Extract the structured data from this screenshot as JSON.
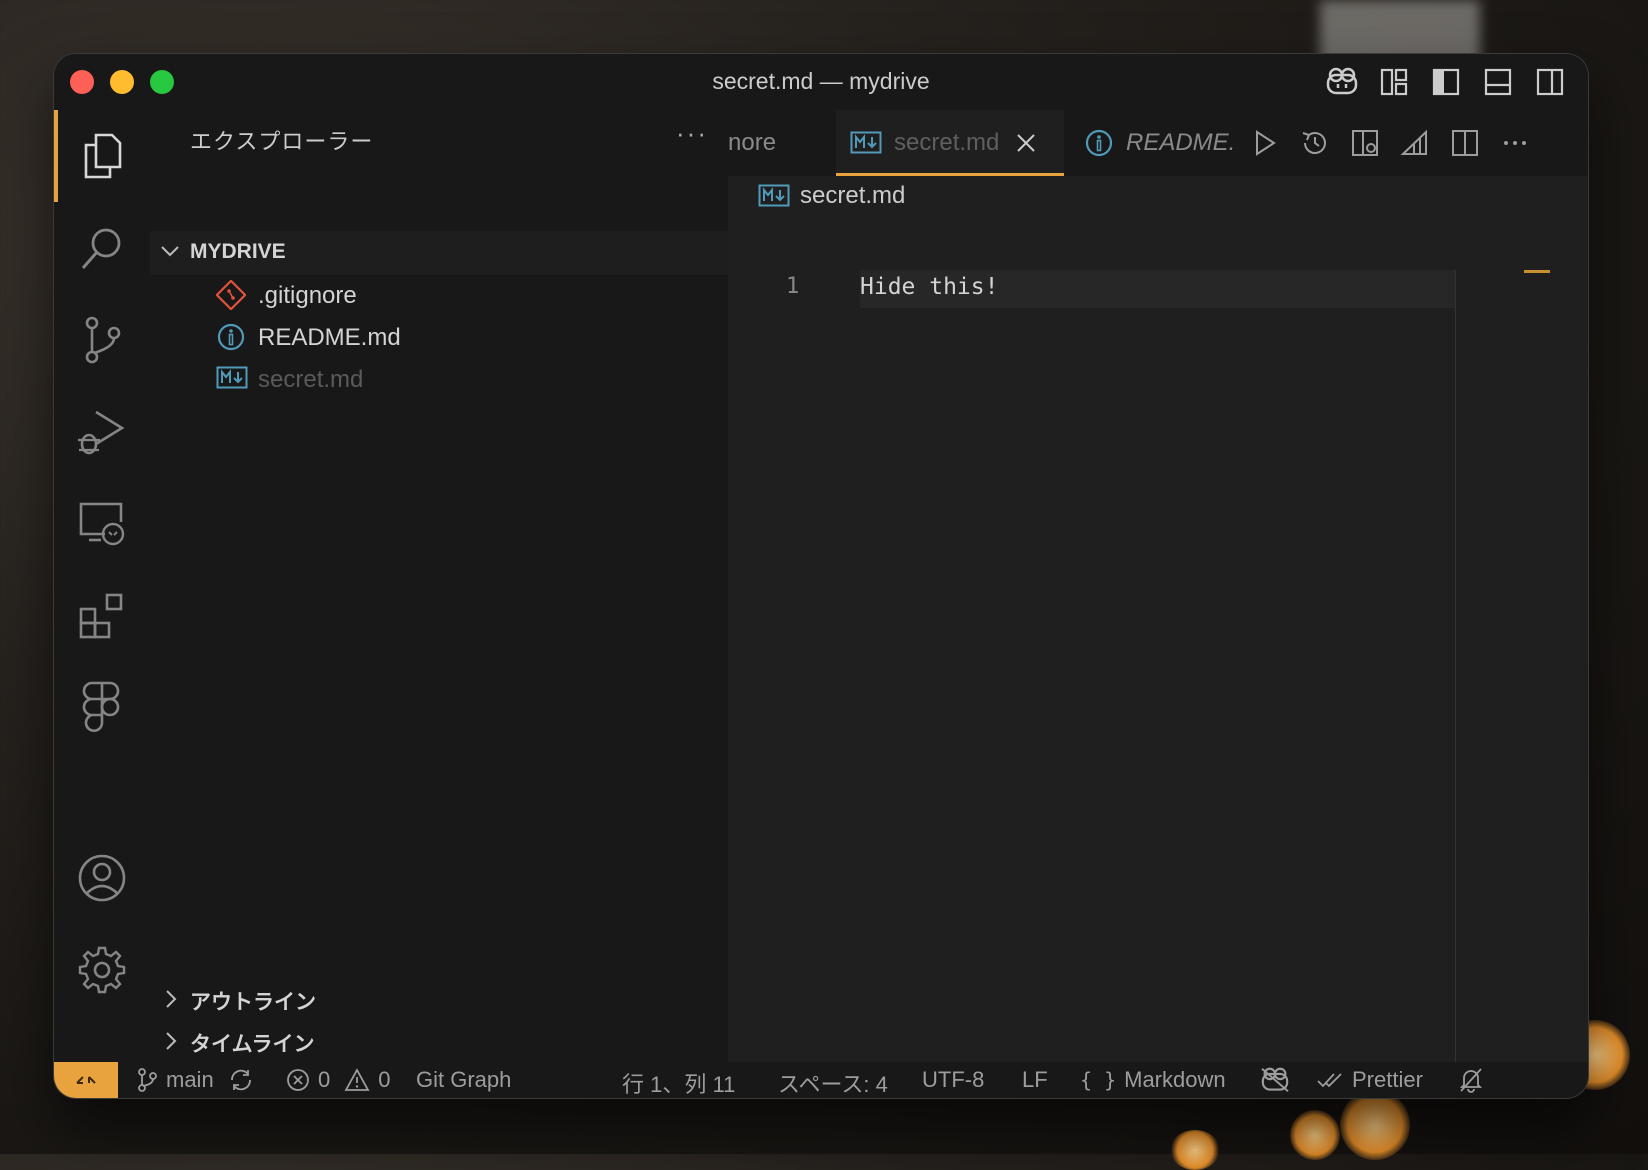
{
  "window": {
    "title": "secret.md — mydrive"
  },
  "sidebar": {
    "title": "エクスプローラー",
    "more": "···",
    "folder": "MYDRIVE",
    "files": [
      {
        "name": ".gitignore",
        "icon": "git-diamond-icon"
      },
      {
        "name": "README.md",
        "icon": "info-icon"
      },
      {
        "name": "secret.md",
        "icon": "markdown-icon"
      }
    ],
    "sections": [
      "アウトライン",
      "タイムライン"
    ]
  },
  "tabs": [
    {
      "label": "nore"
    },
    {
      "label": "secret.md",
      "active": true
    },
    {
      "label": "README."
    }
  ],
  "breadcrumb": {
    "file": "secret.md"
  },
  "editor": {
    "line_number": "1",
    "line_text": "Hide this!"
  },
  "status": {
    "branch": "main",
    "errors": "0",
    "warnings": "0",
    "git_graph": "Git Graph",
    "position": "行 1、列 11",
    "indent": "スペース: 4",
    "encoding": "UTF-8",
    "eol": "LF",
    "language": "Markdown",
    "formatter": "Prettier"
  },
  "colors": {
    "accent": "#e8a33e",
    "markdown_icon": "#519aba",
    "git_icon": "#e0533d"
  }
}
